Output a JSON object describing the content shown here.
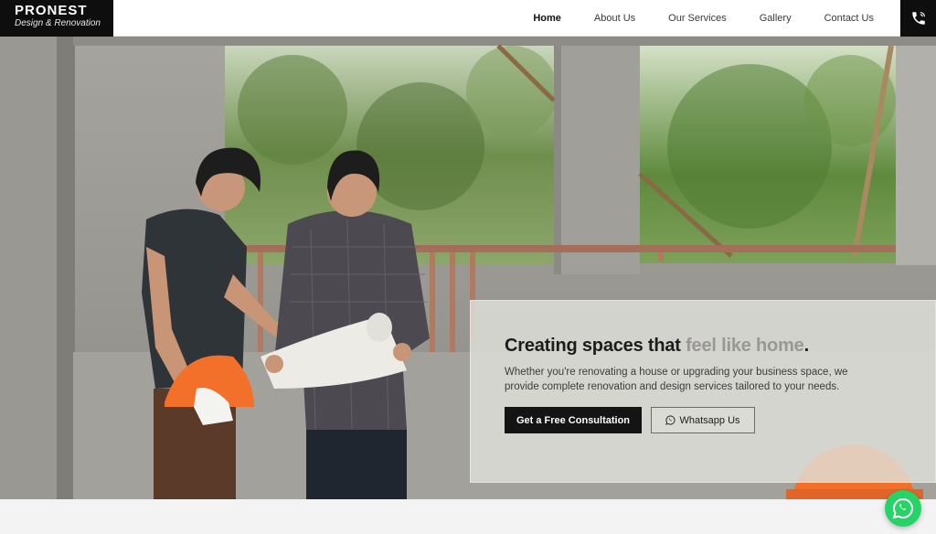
{
  "brand": {
    "name": "PRONEST",
    "tagline": "Design & Renovation"
  },
  "nav": {
    "items": [
      {
        "label": "Home",
        "active": true
      },
      {
        "label": "About Us",
        "active": false
      },
      {
        "label": "Our Services",
        "active": false
      },
      {
        "label": "Gallery",
        "active": false
      },
      {
        "label": "Contact Us",
        "active": false
      }
    ],
    "phone_icon": "phone-icon"
  },
  "hero": {
    "title_main": "Creating spaces that ",
    "title_accent": "feel like home",
    "title_end": ".",
    "description": "Whether you're renovating a house or upgrading your business space, we provide complete renovation and design services tailored to your needs.",
    "primary_button": "Get a Free Consultation",
    "secondary_button": "Whatsapp Us",
    "secondary_icon": "whatsapp-icon"
  },
  "floating": {
    "icon": "whatsapp-icon"
  },
  "colors": {
    "dark": "#0e0e0e",
    "accent_muted": "#9a9895",
    "whatsapp": "#25d366"
  }
}
